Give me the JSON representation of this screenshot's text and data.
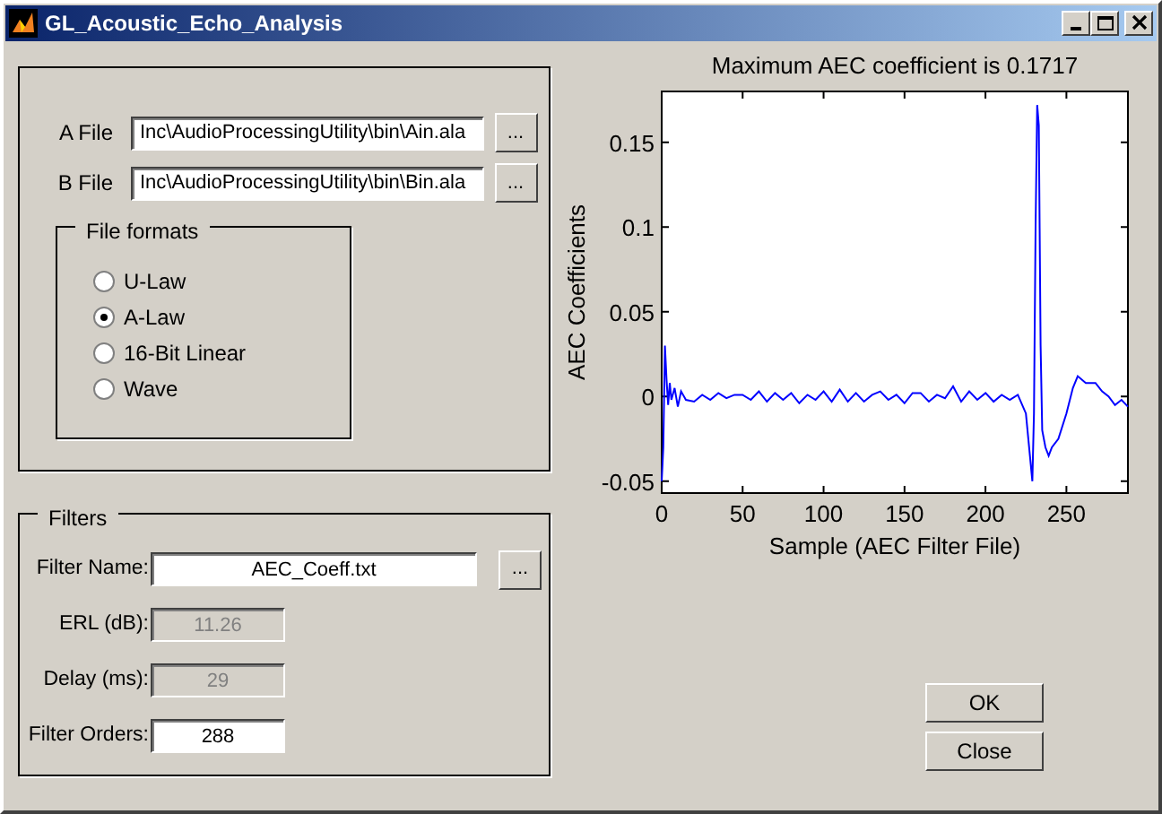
{
  "window": {
    "title": "GL_Acoustic_Echo_Analysis"
  },
  "files": [
    {
      "label": "A File",
      "value": "Inc\\AudioProcessingUtility\\bin\\Ain.ala",
      "button": "..."
    },
    {
      "label": "B File",
      "value": "Inc\\AudioProcessingUtility\\bin\\Bin.ala",
      "button": "..."
    }
  ],
  "file_formats": {
    "title": "File formats",
    "options": [
      {
        "label": "U-Law",
        "selected": false
      },
      {
        "label": "A-Law",
        "selected": true
      },
      {
        "label": "16-Bit Linear",
        "selected": false
      },
      {
        "label": "Wave",
        "selected": false
      }
    ]
  },
  "filters": {
    "title": "Filters",
    "fields": [
      {
        "label": "Filter Name:",
        "value": "AEC_Coeff.txt",
        "disabled": false,
        "button": "..."
      },
      {
        "label": "ERL (dB):",
        "value": "11.26",
        "disabled": true
      },
      {
        "label": "Delay (ms):",
        "value": "29",
        "disabled": true
      },
      {
        "label": "Filter Orders:",
        "value": "288",
        "disabled": false
      }
    ]
  },
  "chart_data": {
    "type": "line",
    "title": "Maximum AEC coefficient is 0.1717",
    "xlabel": "Sample (AEC Filter File)",
    "ylabel": "AEC Coefficients",
    "xlim": [
      0,
      288
    ],
    "ylim": [
      -0.057,
      0.18
    ],
    "xticks": [
      0,
      50,
      100,
      150,
      200,
      250
    ],
    "yticks": [
      -0.05,
      0,
      0.05,
      0.1,
      0.15
    ],
    "x": [
      0,
      1,
      2,
      3,
      4,
      5,
      6,
      8,
      10,
      12,
      15,
      20,
      25,
      30,
      35,
      40,
      45,
      50,
      55,
      60,
      65,
      70,
      75,
      80,
      85,
      90,
      95,
      100,
      105,
      110,
      115,
      120,
      125,
      130,
      135,
      140,
      145,
      150,
      155,
      160,
      165,
      170,
      175,
      180,
      185,
      190,
      195,
      200,
      205,
      210,
      215,
      220,
      225,
      228,
      229,
      230,
      231,
      232,
      233,
      234,
      235,
      237,
      239,
      241,
      245,
      250,
      254,
      257,
      262,
      268,
      272,
      276,
      280,
      284,
      288
    ],
    "series": [
      {
        "color": "#0000ff",
        "values": [
          -0.05,
          -0.03,
          0.03,
          0.01,
          -0.005,
          0.008,
          -0.002,
          0.005,
          -0.006,
          0.003,
          -0.002,
          -0.003,
          0.001,
          -0.002,
          0.002,
          -0.001,
          0.001,
          0.001,
          -0.002,
          0.003,
          -0.003,
          0.002,
          -0.002,
          0.002,
          -0.004,
          0.001,
          -0.002,
          0.003,
          -0.003,
          0.004,
          -0.003,
          0.002,
          -0.003,
          0.001,
          0.003,
          -0.002,
          0.001,
          -0.004,
          0.002,
          0.002,
          -0.003,
          0.001,
          -0.001,
          0.006,
          -0.003,
          0.003,
          -0.002,
          0.002,
          -0.003,
          0.001,
          -0.002,
          0.001,
          -0.01,
          -0.04,
          -0.05,
          -0.01,
          0.1,
          0.172,
          0.16,
          0.03,
          -0.02,
          -0.03,
          -0.035,
          -0.03,
          -0.025,
          -0.01,
          0.005,
          0.012,
          0.008,
          0.008,
          0.003,
          0,
          -0.005,
          -0.002,
          -0.006
        ]
      }
    ]
  },
  "buttons": [
    {
      "label": "OK"
    },
    {
      "label": "Close"
    }
  ]
}
